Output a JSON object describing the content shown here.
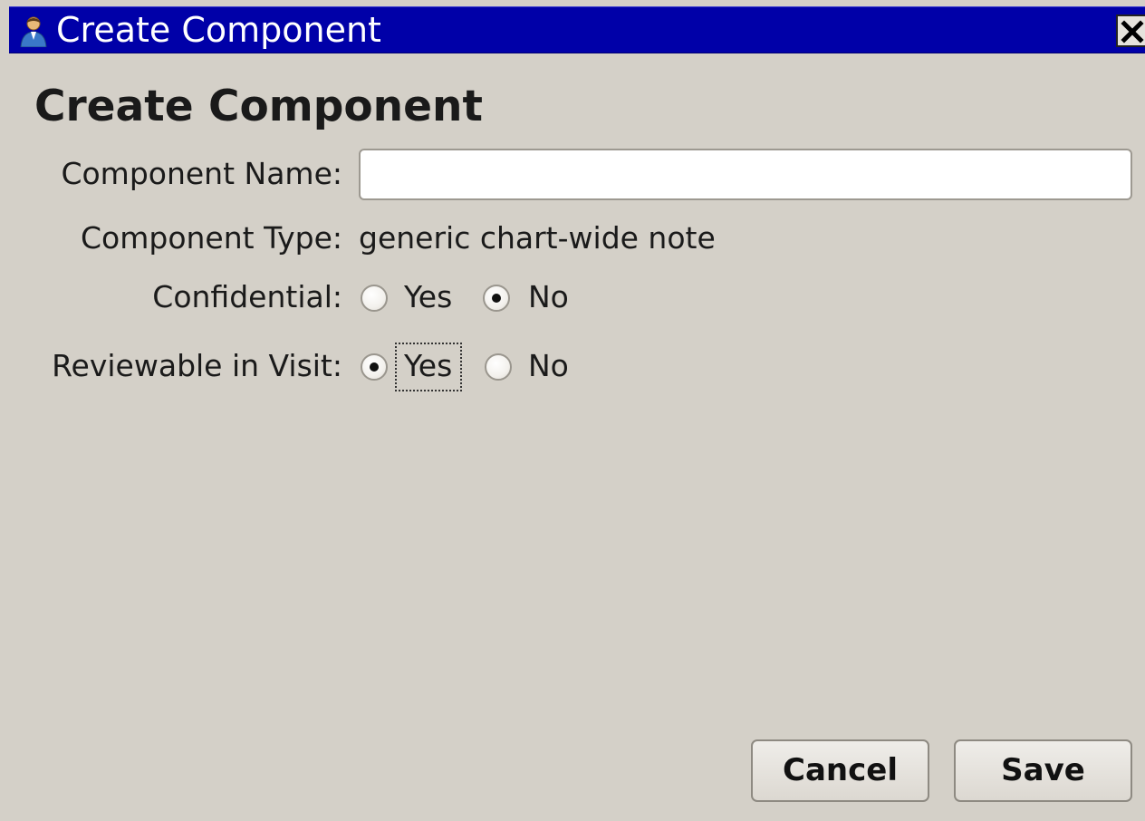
{
  "window": {
    "title": "Create Component",
    "icon": "user-icon",
    "close_icon": "close-icon"
  },
  "dialog": {
    "heading": "Create Component"
  },
  "form": {
    "name_label": "Component Name:",
    "name_value": "",
    "name_placeholder": "",
    "type_label": "Component Type:",
    "type_value": "generic chart-wide note",
    "confidential": {
      "label": "Confidential:",
      "options": [
        "Yes",
        "No"
      ],
      "selected": "No"
    },
    "reviewable": {
      "label": "Reviewable in Visit:",
      "options": [
        "Yes",
        "No"
      ],
      "selected": "Yes",
      "focused": "Yes"
    }
  },
  "buttons": {
    "cancel": "Cancel",
    "save": "Save"
  },
  "colors": {
    "titlebar": "#0000a8",
    "window_bg": "#d4d0c8"
  }
}
